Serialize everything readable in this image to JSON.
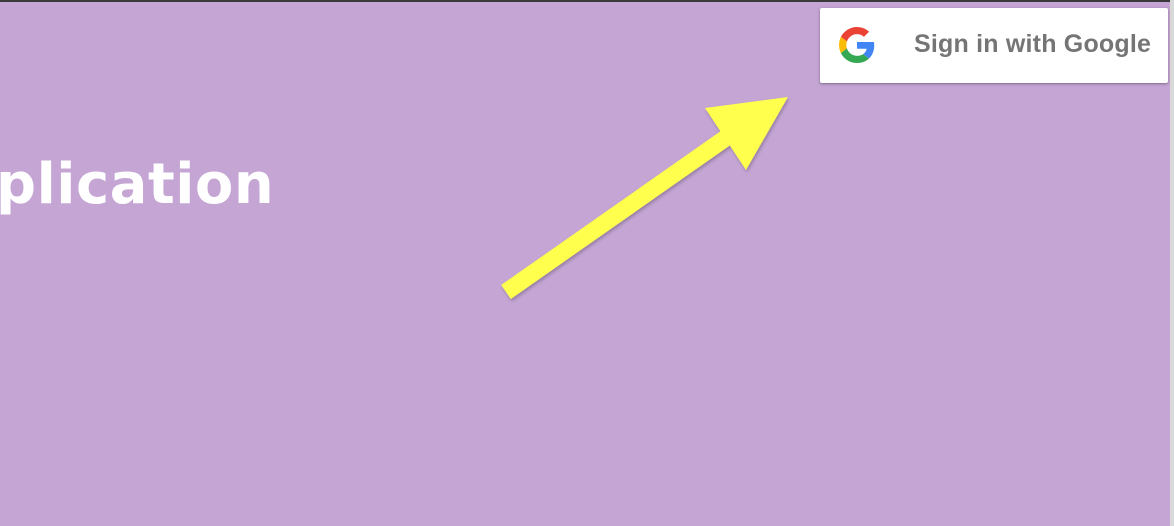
{
  "page": {
    "title": "plication",
    "background_color": "#c4a5d4"
  },
  "header": {
    "signin_button": {
      "label": "Sign in with Google",
      "icon": "google-g-icon"
    }
  },
  "annotation": {
    "arrow_icon": "yellow-arrow-icon",
    "arrow_color": "#ffff4d"
  }
}
